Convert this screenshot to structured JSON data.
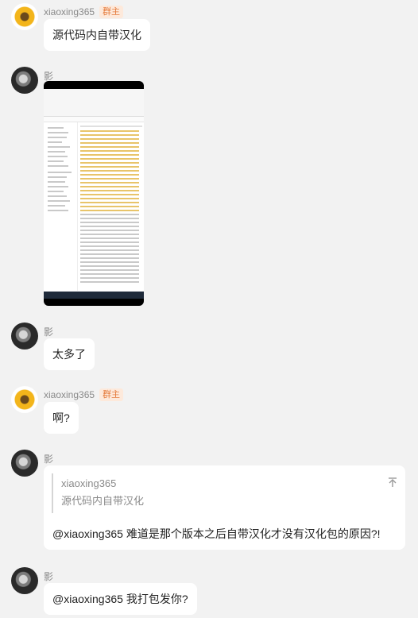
{
  "messages": [
    {
      "sender": "xiaoxing365",
      "badge": "群主",
      "text": "源代码内自带汉化"
    },
    {
      "sender": "影",
      "image_alt": "screenshot"
    },
    {
      "sender": "影",
      "text": "太多了"
    },
    {
      "sender": "xiaoxing365",
      "badge": "群主",
      "text": "啊?"
    },
    {
      "sender": "影",
      "quote": {
        "name": "xiaoxing365",
        "text": "源代码内自带汉化"
      },
      "text": "@xiaoxing365 难道是那个版本之后自带汉化才没有汉化包的原因?!"
    },
    {
      "sender": "影",
      "text": "@xiaoxing365 我打包发你?"
    }
  ],
  "icons": {
    "quote_jump": "arrow-up-to-top-icon"
  },
  "colors": {
    "background": "#f2f2f2",
    "bubble": "#ffffff",
    "name": "#8a8a8a",
    "badge_text": "#e57b3c",
    "badge_bg": "#fde9db"
  }
}
